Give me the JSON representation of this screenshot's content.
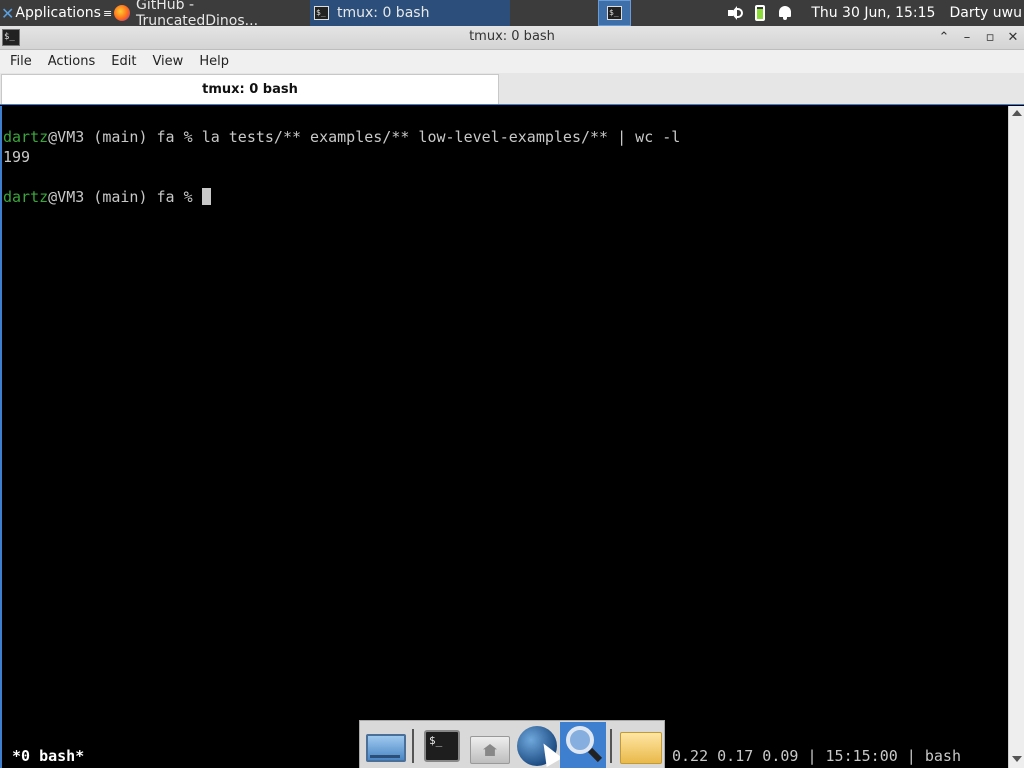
{
  "top_panel": {
    "applications_label": "Applications",
    "tasks": [
      {
        "label": "GitHub - TruncatedDinos..."
      },
      {
        "label": "tmux: 0 bash"
      }
    ],
    "clock": "Thu 30 Jun, 15:15",
    "user": "Darty uwu"
  },
  "window": {
    "title": "tmux: 0 bash",
    "controls": {
      "shade": "⌃",
      "minimize": "–",
      "maximize": "▫",
      "close": "✕"
    }
  },
  "menubar": {
    "items": [
      {
        "label": "File"
      },
      {
        "label": "Actions"
      },
      {
        "label": "Edit"
      },
      {
        "label": "View"
      },
      {
        "label": "Help"
      }
    ]
  },
  "tabs": [
    {
      "label": "tmux: 0 bash",
      "active": true
    }
  ],
  "terminal": {
    "prompt_user": "dartz",
    "prompt_rest": "@VM3 (main) fa % ",
    "command1": "la tests/** examples/** low-level-examples/** | wc -l",
    "output1": "199"
  },
  "tmux_status": {
    "left": "*0 bash*",
    "right": "0.22 0.17 0.09 | 15:15:00 | bash"
  },
  "dock": {
    "items": [
      {
        "icon": "desktop-icon"
      },
      {
        "icon": "terminal-icon"
      },
      {
        "icon": "home-folder-icon"
      },
      {
        "icon": "web-browser-icon"
      },
      {
        "icon": "search-icon"
      },
      {
        "icon": "files-folder-icon"
      }
    ]
  },
  "colors": {
    "panel": "#3c3c3c",
    "accent": "#3f7fcf",
    "prompt_user": "#3aa53a",
    "terminal_bg": "#000000"
  }
}
